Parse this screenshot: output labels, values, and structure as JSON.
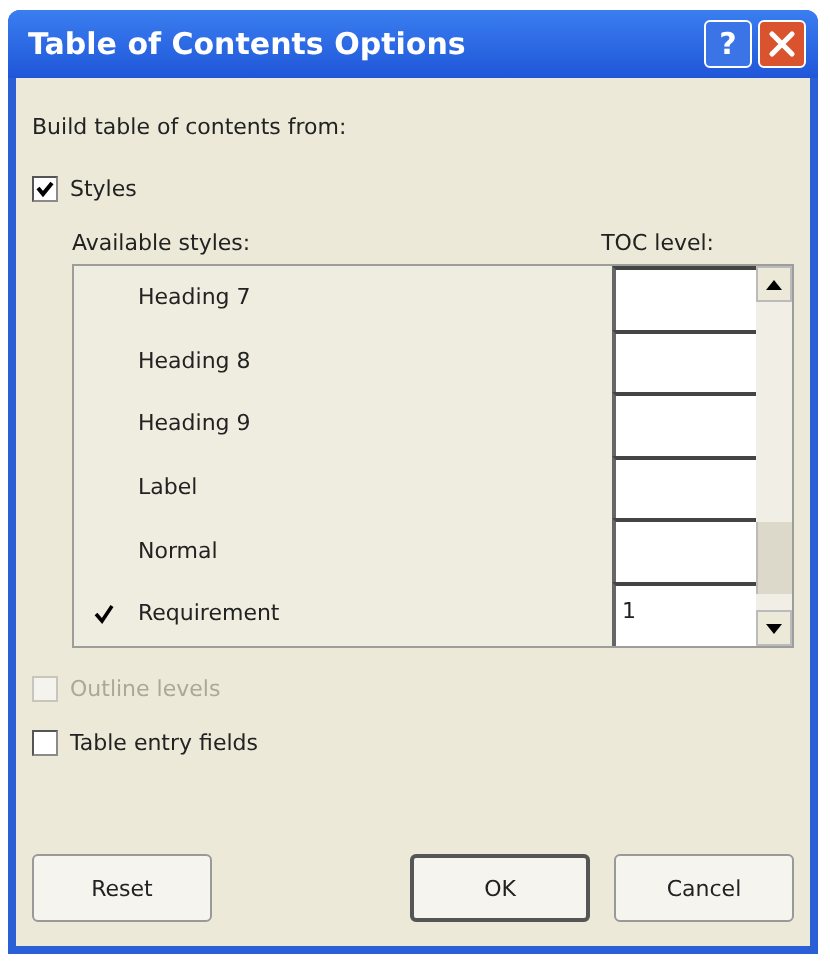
{
  "window": {
    "title": "Table of Contents Options",
    "help_button": "?"
  },
  "build_label": "Build table of contents from:",
  "styles_option": {
    "label": "Styles",
    "checked": true,
    "disabled": false
  },
  "columns": [
    "Available styles:",
    "TOC level:"
  ],
  "styles": [
    {
      "name": "Heading 7",
      "marked": false
    },
    {
      "name": "Heading 8",
      "marked": false
    },
    {
      "name": "Heading 9",
      "marked": false
    },
    {
      "name": "Label",
      "marked": false
    },
    {
      "name": "Normal",
      "marked": false
    },
    {
      "name": "Requirement",
      "marked": true,
      "level": "1"
    }
  ],
  "options": [
    {
      "label": "Outline levels",
      "checked": false,
      "disabled": true
    },
    {
      "label": "Table entry fields",
      "checked": false,
      "disabled": false
    }
  ],
  "buttons": [
    {
      "label": "Reset",
      "default": false
    },
    {
      "label": "OK",
      "default": true
    },
    {
      "label": "Cancel",
      "default": false
    }
  ]
}
